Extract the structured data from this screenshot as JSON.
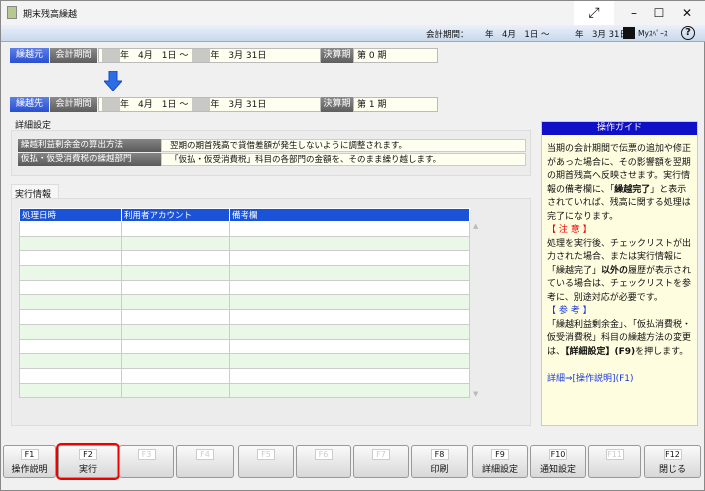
{
  "window": {
    "title": "期末残高繰越",
    "controls": [
      "expand",
      "minimize",
      "maximize",
      "close"
    ]
  },
  "header": {
    "period_label": "会計期間：",
    "period": "年　4月　1日 ～　　　年　3月 31日",
    "myspace": "Myｽﾍﾟｰｽ"
  },
  "source": {
    "tag": "繰越元",
    "period_label": "会計期間",
    "from": "年　4月　1日 ～",
    "to": "年　3月 31日",
    "term_label": "決算期",
    "term": "第 0 期"
  },
  "dest": {
    "tag": "繰越先",
    "period_label": "会計期間",
    "from": "年　4月　1日 ～",
    "to": "年　3月 31日",
    "term_label": "決算期",
    "term": "第 1 期"
  },
  "details": {
    "title": "詳細設定",
    "rows": [
      {
        "label": "繰越利益剰余金の算出方法",
        "value": "翌期の期首残高で貸借差額が発生しないように調整されます。"
      },
      {
        "label": "仮払・仮受消費税の繰越部門",
        "value": "「仮払・仮受消費税」科目の各部門の金額を、そのまま繰り越します。"
      }
    ]
  },
  "exec": {
    "tab": "実行情報",
    "columns": [
      "処理日時",
      "利用者アカウント",
      "備考欄"
    ],
    "rows": []
  },
  "guide": {
    "title": "操作ガイド",
    "p1": "当期の会計期間で伝票の追加や修正があった場合に、その影響額を翌期の期首残高へ反映させます。実行情報の備考欄に、「",
    "p1b": "繰越完了",
    "p1c": "」と表示されていれば、残高に関する処理は完了になります。",
    "note": "【 注 意 】",
    "p2": "処理を実行後、チェックリストが出力された場合、または実行情報に「繰越完了」",
    "p2b": "以外の",
    "p2c": "履歴が表示されている場合は、チェックリストを参考に、別途対応が必要です。",
    "ref": "【 参 考 】",
    "p3": "「繰越利益剰余金」、「仮払消費税・仮受消費税」科目の繰越方法の変更は、",
    "p3b": "【詳細設定】(F9)",
    "p3c": "を押します。",
    "link": "詳細⇒[操作説明](F1)"
  },
  "fkeys": [
    {
      "key": "F1",
      "label": "操作説明",
      "enabled": true
    },
    {
      "key": "F2",
      "label": "実行",
      "enabled": true,
      "highlighted": true
    },
    {
      "key": "F3",
      "label": "",
      "enabled": false
    },
    {
      "key": "F4",
      "label": "",
      "enabled": false
    },
    {
      "key": "F5",
      "label": "",
      "enabled": false
    },
    {
      "key": "F6",
      "label": "",
      "enabled": false
    },
    {
      "key": "F7",
      "label": "",
      "enabled": false
    },
    {
      "key": "F8",
      "label": "印刷",
      "enabled": true
    },
    {
      "key": "F9",
      "label": "詳細設定",
      "enabled": true
    },
    {
      "key": "F10",
      "label": "通知設定",
      "enabled": true
    },
    {
      "key": "F11",
      "label": "",
      "enabled": false
    },
    {
      "key": "F12",
      "label": "閉じる",
      "enabled": true
    }
  ],
  "colors": {
    "blue_tag": "#2a4fd0",
    "table_header": "#1a52d8",
    "guide_header": "#1010c8",
    "highlight": "#e00000"
  }
}
